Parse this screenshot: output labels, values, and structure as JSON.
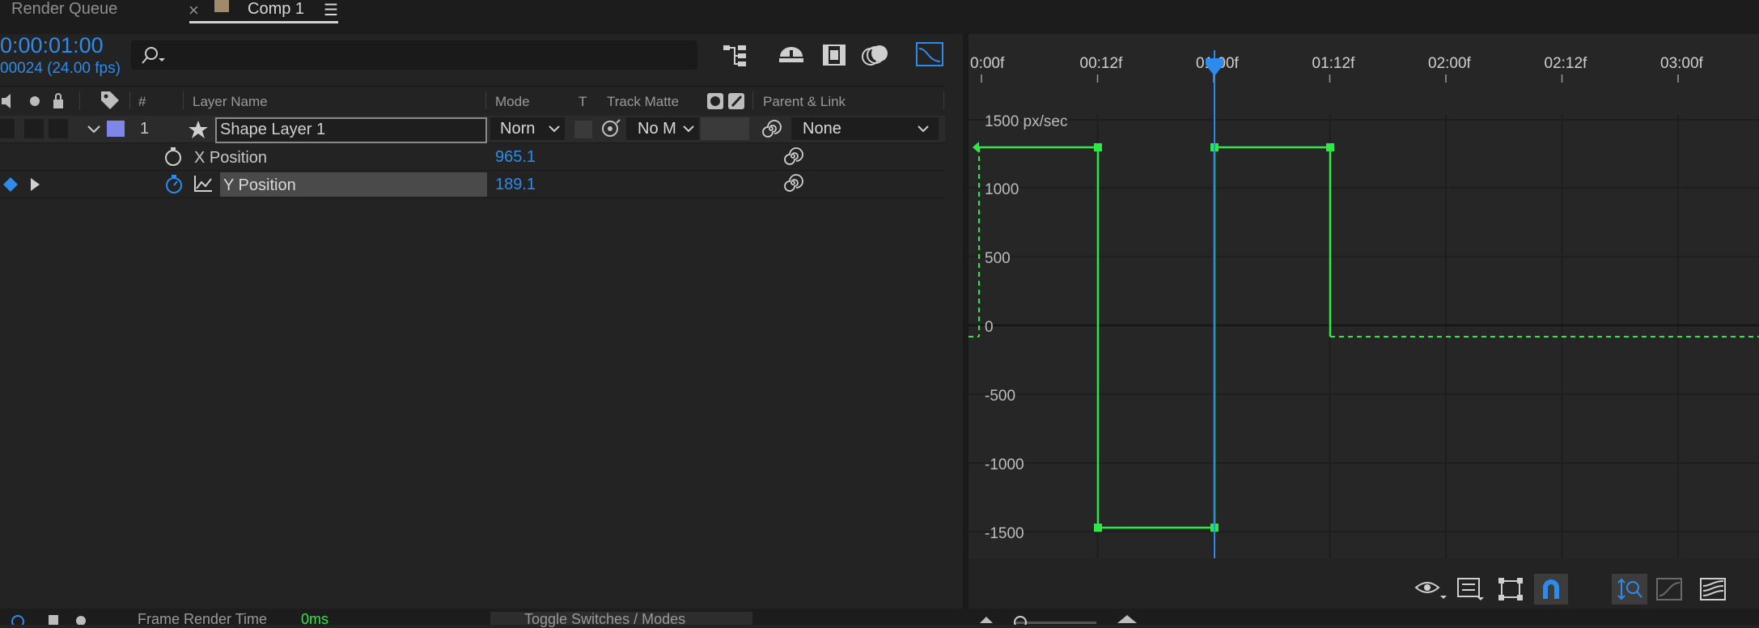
{
  "tabs": {
    "render_queue": "Render Queue",
    "close_glyph": "×",
    "comp": "Comp 1",
    "menu_glyph": "☰"
  },
  "comp": {
    "timecode": "0:00:01:00",
    "frame_info": "00024 (24.00 fps)",
    "search_placeholder": ""
  },
  "columns": {
    "number": "#",
    "layer_name": "Layer Name",
    "mode": "Mode",
    "t": "T",
    "track_matte": "Track Matte",
    "parent_link": "Parent & Link"
  },
  "layer": {
    "index": "1",
    "name": "Shape Layer 1",
    "label_color": "#7f86e8",
    "mode_value": "Norn",
    "matte_value": "No M",
    "parent_value": "None"
  },
  "properties": [
    {
      "name": "X Position",
      "value": "965.1",
      "selected": false
    },
    {
      "name": "Y Position",
      "value": "189.1",
      "selected": true
    }
  ],
  "graph": {
    "unit_label": "1500 px/sec",
    "y_tick_labels": [
      "1000",
      "500",
      "0",
      "-500",
      "-1000",
      "-1500"
    ],
    "time_labels": [
      "0:00f",
      "00:12f",
      "01:00f",
      "01:12f",
      "02:00f",
      "02:12f",
      "03:00f"
    ],
    "curve_color": "#2ee845",
    "playhead_color": "#2d8ceb"
  },
  "status": {
    "frame_render_label": "Frame Render Time",
    "frame_render_value": "0ms",
    "toggle_label": "Toggle Switches / Modes"
  }
}
